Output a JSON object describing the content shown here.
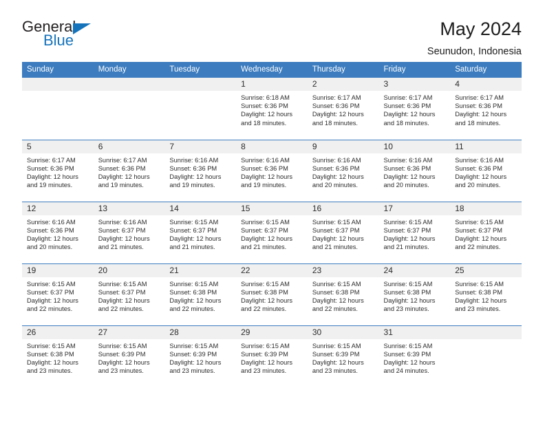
{
  "brand": {
    "name_part1": "General",
    "name_part2": "Blue",
    "triangle_icon": "triangle-icon",
    "accent_color": "#1573bb"
  },
  "header": {
    "title": "May 2024",
    "subtitle": "Seunudon, Indonesia"
  },
  "theme": {
    "header_row_bg": "#3c7cbf",
    "daynum_bg": "#f0f0f0",
    "grid_line": "#3c7cbf",
    "text": "#2b2b2b"
  },
  "weekday_headers": [
    "Sunday",
    "Monday",
    "Tuesday",
    "Wednesday",
    "Thursday",
    "Friday",
    "Saturday"
  ],
  "labels": {
    "sunrise": "Sunrise:",
    "sunset": "Sunset:",
    "daylight": "Daylight:"
  },
  "weeks": [
    [
      {
        "day": "",
        "empty": true
      },
      {
        "day": "",
        "empty": true
      },
      {
        "day": "",
        "empty": true
      },
      {
        "day": "1",
        "sunrise": "Sunrise: 6:18 AM",
        "sunset": "Sunset: 6:36 PM",
        "daylight_l1": "Daylight: 12 hours",
        "daylight_l2": "and 18 minutes."
      },
      {
        "day": "2",
        "sunrise": "Sunrise: 6:17 AM",
        "sunset": "Sunset: 6:36 PM",
        "daylight_l1": "Daylight: 12 hours",
        "daylight_l2": "and 18 minutes."
      },
      {
        "day": "3",
        "sunrise": "Sunrise: 6:17 AM",
        "sunset": "Sunset: 6:36 PM",
        "daylight_l1": "Daylight: 12 hours",
        "daylight_l2": "and 18 minutes."
      },
      {
        "day": "4",
        "sunrise": "Sunrise: 6:17 AM",
        "sunset": "Sunset: 6:36 PM",
        "daylight_l1": "Daylight: 12 hours",
        "daylight_l2": "and 18 minutes."
      }
    ],
    [
      {
        "day": "5",
        "sunrise": "Sunrise: 6:17 AM",
        "sunset": "Sunset: 6:36 PM",
        "daylight_l1": "Daylight: 12 hours",
        "daylight_l2": "and 19 minutes."
      },
      {
        "day": "6",
        "sunrise": "Sunrise: 6:17 AM",
        "sunset": "Sunset: 6:36 PM",
        "daylight_l1": "Daylight: 12 hours",
        "daylight_l2": "and 19 minutes."
      },
      {
        "day": "7",
        "sunrise": "Sunrise: 6:16 AM",
        "sunset": "Sunset: 6:36 PM",
        "daylight_l1": "Daylight: 12 hours",
        "daylight_l2": "and 19 minutes."
      },
      {
        "day": "8",
        "sunrise": "Sunrise: 6:16 AM",
        "sunset": "Sunset: 6:36 PM",
        "daylight_l1": "Daylight: 12 hours",
        "daylight_l2": "and 19 minutes."
      },
      {
        "day": "9",
        "sunrise": "Sunrise: 6:16 AM",
        "sunset": "Sunset: 6:36 PM",
        "daylight_l1": "Daylight: 12 hours",
        "daylight_l2": "and 20 minutes."
      },
      {
        "day": "10",
        "sunrise": "Sunrise: 6:16 AM",
        "sunset": "Sunset: 6:36 PM",
        "daylight_l1": "Daylight: 12 hours",
        "daylight_l2": "and 20 minutes."
      },
      {
        "day": "11",
        "sunrise": "Sunrise: 6:16 AM",
        "sunset": "Sunset: 6:36 PM",
        "daylight_l1": "Daylight: 12 hours",
        "daylight_l2": "and 20 minutes."
      }
    ],
    [
      {
        "day": "12",
        "sunrise": "Sunrise: 6:16 AM",
        "sunset": "Sunset: 6:36 PM",
        "daylight_l1": "Daylight: 12 hours",
        "daylight_l2": "and 20 minutes."
      },
      {
        "day": "13",
        "sunrise": "Sunrise: 6:16 AM",
        "sunset": "Sunset: 6:37 PM",
        "daylight_l1": "Daylight: 12 hours",
        "daylight_l2": "and 21 minutes."
      },
      {
        "day": "14",
        "sunrise": "Sunrise: 6:15 AM",
        "sunset": "Sunset: 6:37 PM",
        "daylight_l1": "Daylight: 12 hours",
        "daylight_l2": "and 21 minutes."
      },
      {
        "day": "15",
        "sunrise": "Sunrise: 6:15 AM",
        "sunset": "Sunset: 6:37 PM",
        "daylight_l1": "Daylight: 12 hours",
        "daylight_l2": "and 21 minutes."
      },
      {
        "day": "16",
        "sunrise": "Sunrise: 6:15 AM",
        "sunset": "Sunset: 6:37 PM",
        "daylight_l1": "Daylight: 12 hours",
        "daylight_l2": "and 21 minutes."
      },
      {
        "day": "17",
        "sunrise": "Sunrise: 6:15 AM",
        "sunset": "Sunset: 6:37 PM",
        "daylight_l1": "Daylight: 12 hours",
        "daylight_l2": "and 21 minutes."
      },
      {
        "day": "18",
        "sunrise": "Sunrise: 6:15 AM",
        "sunset": "Sunset: 6:37 PM",
        "daylight_l1": "Daylight: 12 hours",
        "daylight_l2": "and 22 minutes."
      }
    ],
    [
      {
        "day": "19",
        "sunrise": "Sunrise: 6:15 AM",
        "sunset": "Sunset: 6:37 PM",
        "daylight_l1": "Daylight: 12 hours",
        "daylight_l2": "and 22 minutes."
      },
      {
        "day": "20",
        "sunrise": "Sunrise: 6:15 AM",
        "sunset": "Sunset: 6:37 PM",
        "daylight_l1": "Daylight: 12 hours",
        "daylight_l2": "and 22 minutes."
      },
      {
        "day": "21",
        "sunrise": "Sunrise: 6:15 AM",
        "sunset": "Sunset: 6:38 PM",
        "daylight_l1": "Daylight: 12 hours",
        "daylight_l2": "and 22 minutes."
      },
      {
        "day": "22",
        "sunrise": "Sunrise: 6:15 AM",
        "sunset": "Sunset: 6:38 PM",
        "daylight_l1": "Daylight: 12 hours",
        "daylight_l2": "and 22 minutes."
      },
      {
        "day": "23",
        "sunrise": "Sunrise: 6:15 AM",
        "sunset": "Sunset: 6:38 PM",
        "daylight_l1": "Daylight: 12 hours",
        "daylight_l2": "and 22 minutes."
      },
      {
        "day": "24",
        "sunrise": "Sunrise: 6:15 AM",
        "sunset": "Sunset: 6:38 PM",
        "daylight_l1": "Daylight: 12 hours",
        "daylight_l2": "and 23 minutes."
      },
      {
        "day": "25",
        "sunrise": "Sunrise: 6:15 AM",
        "sunset": "Sunset: 6:38 PM",
        "daylight_l1": "Daylight: 12 hours",
        "daylight_l2": "and 23 minutes."
      }
    ],
    [
      {
        "day": "26",
        "sunrise": "Sunrise: 6:15 AM",
        "sunset": "Sunset: 6:38 PM",
        "daylight_l1": "Daylight: 12 hours",
        "daylight_l2": "and 23 minutes."
      },
      {
        "day": "27",
        "sunrise": "Sunrise: 6:15 AM",
        "sunset": "Sunset: 6:39 PM",
        "daylight_l1": "Daylight: 12 hours",
        "daylight_l2": "and 23 minutes."
      },
      {
        "day": "28",
        "sunrise": "Sunrise: 6:15 AM",
        "sunset": "Sunset: 6:39 PM",
        "daylight_l1": "Daylight: 12 hours",
        "daylight_l2": "and 23 minutes."
      },
      {
        "day": "29",
        "sunrise": "Sunrise: 6:15 AM",
        "sunset": "Sunset: 6:39 PM",
        "daylight_l1": "Daylight: 12 hours",
        "daylight_l2": "and 23 minutes."
      },
      {
        "day": "30",
        "sunrise": "Sunrise: 6:15 AM",
        "sunset": "Sunset: 6:39 PM",
        "daylight_l1": "Daylight: 12 hours",
        "daylight_l2": "and 23 minutes."
      },
      {
        "day": "31",
        "sunrise": "Sunrise: 6:15 AM",
        "sunset": "Sunset: 6:39 PM",
        "daylight_l1": "Daylight: 12 hours",
        "daylight_l2": "and 24 minutes."
      },
      {
        "day": "",
        "empty": true
      }
    ]
  ]
}
